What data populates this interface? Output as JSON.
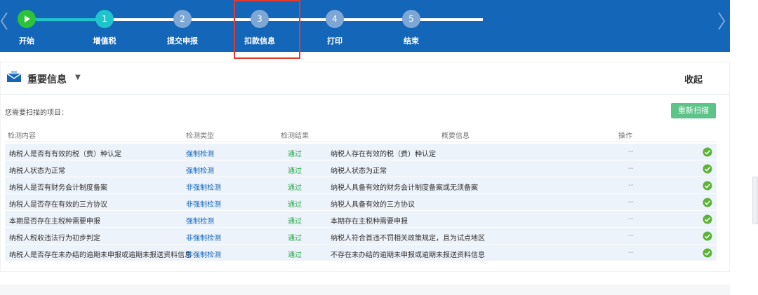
{
  "steps": [
    {
      "num": "",
      "label": "开始",
      "state": "start"
    },
    {
      "num": "1",
      "label": "增值税",
      "state": "done"
    },
    {
      "num": "2",
      "label": "提交申报",
      "state": "todo"
    },
    {
      "num": "3",
      "label": "扣款信息",
      "state": "todo"
    },
    {
      "num": "4",
      "label": "打印",
      "state": "todo"
    },
    {
      "num": "5",
      "label": "结束",
      "state": "todo"
    }
  ],
  "panel": {
    "title": "重要信息",
    "collapse_label": "收起",
    "scan_label": "您需要扫描的项目：",
    "rescan_label": "重新扫描"
  },
  "table": {
    "headers": [
      "检测内容",
      "检测类型",
      "检测结果",
      "概要信息",
      "操作"
    ],
    "rows": [
      {
        "content": "纳税人是否有有效的税（费）种认定",
        "type": "强制检测",
        "result": "通过",
        "summary": "纳税人存在有效的税（费）种认定",
        "op": "--"
      },
      {
        "content": "纳税人状态为正常",
        "type": "强制检测",
        "result": "通过",
        "summary": "纳税人状态为正常",
        "op": "--"
      },
      {
        "content": "纳税人是否有财务会计制度备案",
        "type": "非强制检测",
        "result": "通过",
        "summary": "纳税人具备有效的财务会计制度备案或无须备案",
        "op": "--"
      },
      {
        "content": "纳税人是否存在有效的三方协议",
        "type": "非强制检测",
        "result": "通过",
        "summary": "纳税人具备有效的三方协议",
        "op": "--"
      },
      {
        "content": "本期是否存在主税种需要申报",
        "type": "强制检测",
        "result": "通过",
        "summary": "本期存在主税种需要申报",
        "op": "--"
      },
      {
        "content": "纳税人税收违法行为初步判定",
        "type": "非强制检测",
        "result": "通过",
        "summary": "纳税人符合首违不罚相关政策规定，且为试点地区",
        "op": "--"
      },
      {
        "content": "纳税人是否存在未办结的逾期未申报或逾期未报送资料信息",
        "type": "非强制检测",
        "result": "通过",
        "summary": "不存在未办结的逾期未申报或逾期未报送资料信息",
        "op": "--"
      }
    ]
  },
  "colors": {
    "bar": "#1466b8",
    "done": "#1fc4cc",
    "start": "#2bc33a",
    "pass": "#2aa84a",
    "highlight": "#e23b2e"
  },
  "icons": {
    "left": "chevron-left-icon",
    "right": "chevron-right-icon",
    "panel": "envelope-icon",
    "status": "check-circle-icon"
  }
}
